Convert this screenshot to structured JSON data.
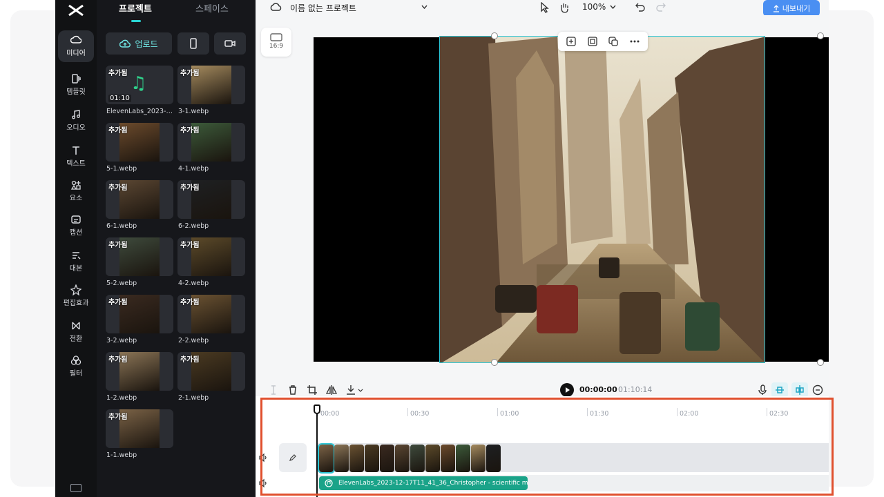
{
  "header": {
    "project_title": "이름 없는 프로젝트",
    "zoom": "100%",
    "export_label": "내보내기"
  },
  "rail": {
    "items": [
      {
        "label": "미디어",
        "icon": "cloud-icon",
        "active": true
      },
      {
        "label": "템플릿",
        "icon": "template-icon"
      },
      {
        "label": "오디오",
        "icon": "music-icon"
      },
      {
        "label": "텍스트",
        "icon": "text-icon"
      },
      {
        "label": "요소",
        "icon": "elements-icon"
      },
      {
        "label": "캡션",
        "icon": "caption-icon"
      },
      {
        "label": "대본",
        "icon": "script-icon"
      },
      {
        "label": "편집효과",
        "icon": "effects-icon"
      },
      {
        "label": "전환",
        "icon": "transition-icon"
      },
      {
        "label": "필터",
        "icon": "filter-icon"
      }
    ]
  },
  "panel": {
    "tab_project": "프로젝트",
    "tab_space": "스페이스",
    "upload_label": "업로드",
    "added_badge": "추가됨",
    "media": [
      {
        "name": "ElevenLabs_2023-1...",
        "type": "audio",
        "duration": "01:10",
        "color": "#2b2d33"
      },
      {
        "name": "3-1.webp",
        "color": "#a48a5e"
      },
      {
        "name": "5-1.webp",
        "color": "#6b4a2c"
      },
      {
        "name": "4-1.webp",
        "color": "#3c5a3a"
      },
      {
        "name": "6-1.webp",
        "color": "#5a4632"
      },
      {
        "name": "6-2.webp",
        "color": "#1e2022"
      },
      {
        "name": "5-2.webp",
        "color": "#3e4a3c"
      },
      {
        "name": "4-2.webp",
        "color": "#5c4a2a"
      },
      {
        "name": "3-2.webp",
        "color": "#3a2a20"
      },
      {
        "name": "2-2.webp",
        "color": "#6a5232"
      },
      {
        "name": "1-2.webp",
        "color": "#8a7456"
      },
      {
        "name": "2-1.webp",
        "color": "#4a3a22"
      },
      {
        "name": "1-1.webp",
        "color": "#7a6246"
      }
    ]
  },
  "canvas": {
    "ratio_label": "16:9"
  },
  "controls": {
    "current_time": "00:00:00",
    "total_time": "01:10:14"
  },
  "timeline": {
    "ruler": [
      "00:00",
      "00:30",
      "01:00",
      "01:30",
      "02:00",
      "02:30"
    ],
    "clip_colors": [
      "#7a6246",
      "#8a7456",
      "#6a5232",
      "#4a3a22",
      "#3a2a20",
      "#5a4632",
      "#3e4a3c",
      "#5c4a2a",
      "#6b4a2c",
      "#3c5a3a",
      "#a48a5e",
      "#1e2022"
    ],
    "audio_clip_label": "ElevenLabs_2023-12-17T11_41_36_Christopher - scientific m"
  }
}
